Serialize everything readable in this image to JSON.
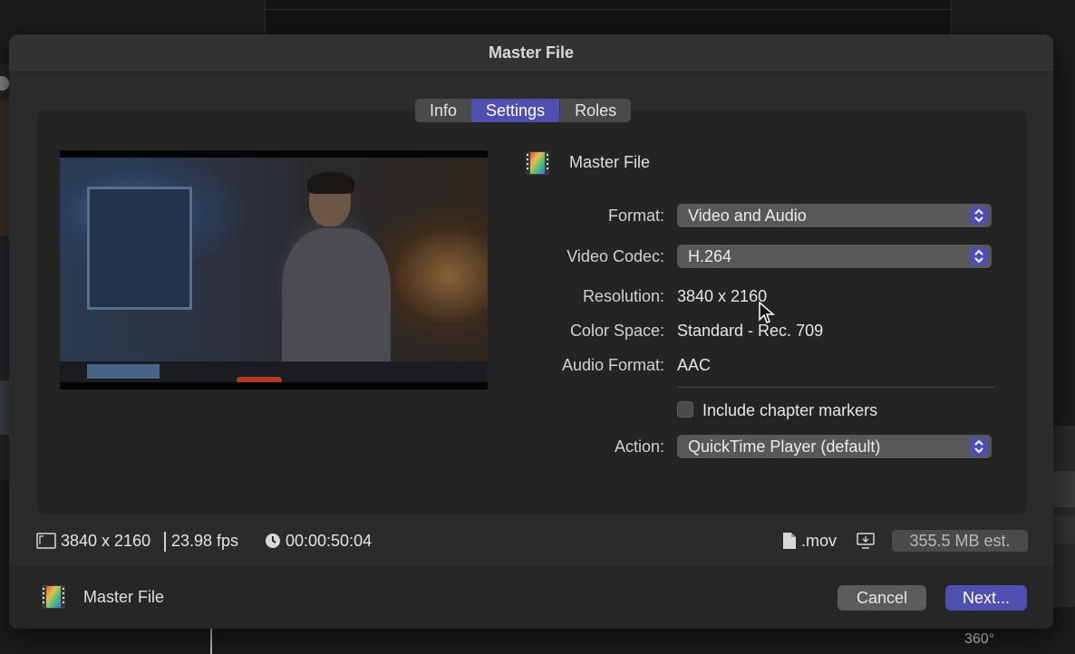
{
  "dialog": {
    "title": "Master File"
  },
  "tabs": [
    {
      "label": "Info",
      "active": false
    },
    {
      "label": "Settings",
      "active": true
    },
    {
      "label": "Roles",
      "active": false
    }
  ],
  "header": {
    "label": "Master File",
    "icon": "filmstrip-icon"
  },
  "settings": {
    "format_label": "Format:",
    "format_value": "Video and Audio",
    "codec_label": "Video Codec:",
    "codec_value": "H.264",
    "resolution_label": "Resolution:",
    "resolution_value": "3840 x 2160",
    "colorspace_label": "Color Space:",
    "colorspace_value": "Standard - Rec. 709",
    "audio_label": "Audio Format:",
    "audio_value": "AAC",
    "chapter_label": "Include chapter markers",
    "chapter_checked": false,
    "action_label": "Action:",
    "action_value": "QuickTime Player (default)"
  },
  "infobar": {
    "dimensions": "3840 x 2160",
    "fps": "23.98 fps",
    "duration": "00:00:50:04",
    "extension": ".mov",
    "size": "355.5 MB est."
  },
  "footer": {
    "label": "Master File",
    "cancel": "Cancel",
    "next": "Next..."
  },
  "background": {
    "degree": "360°"
  },
  "colors": {
    "accent": "#4f4fb0",
    "panel": "#2b2b2c"
  }
}
